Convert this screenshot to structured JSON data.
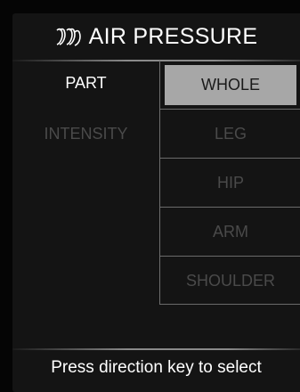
{
  "header": {
    "title": "AIR PRESSURE",
    "icon": "air-coil-icon"
  },
  "labels": {
    "part": "PART",
    "intensity": "INTENSITY"
  },
  "options": [
    {
      "label": "WHOLE",
      "selected": true
    },
    {
      "label": "LEG",
      "selected": false
    },
    {
      "label": "HIP",
      "selected": false
    },
    {
      "label": "ARM",
      "selected": false
    },
    {
      "label": "SHOULDER",
      "selected": false
    }
  ],
  "footer": {
    "hint": "Press direction key to select"
  },
  "colors": {
    "background": "#141414",
    "selected_bg": "#a7a7a7",
    "active_text": "#ffffff",
    "inactive_text": "#4a4a4a"
  }
}
